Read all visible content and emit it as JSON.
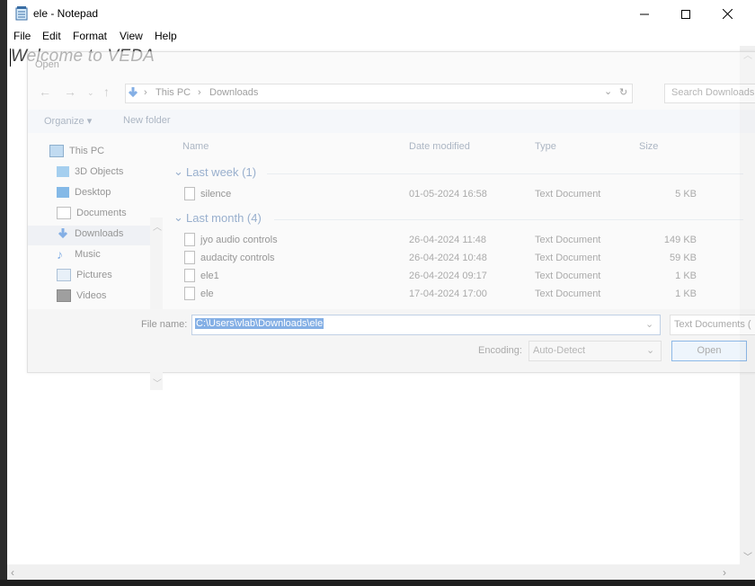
{
  "notepad": {
    "title": "ele - Notepad",
    "menu": [
      "File",
      "Edit",
      "Format",
      "View",
      "Help"
    ],
    "content": "Welcome to VEDA"
  },
  "dialog": {
    "title": "Open",
    "breadcrumb": [
      "This PC",
      "Downloads"
    ],
    "search_placeholder": "Search Downloads",
    "toolbar": {
      "organize": "Organize ▾",
      "new_folder": "New folder"
    },
    "nav_items": [
      {
        "label": "This PC",
        "icon": "pc-icon"
      },
      {
        "label": "3D Objects",
        "icon": "cube-icon"
      },
      {
        "label": "Desktop",
        "icon": "desktop-icon"
      },
      {
        "label": "Documents",
        "icon": "documents-icon"
      },
      {
        "label": "Downloads",
        "icon": "download-arrow-icon"
      },
      {
        "label": "Music",
        "icon": "music-note-icon"
      },
      {
        "label": "Pictures",
        "icon": "pictures-icon"
      },
      {
        "label": "Videos",
        "icon": "film-icon"
      }
    ],
    "columns": {
      "name": "Name",
      "date": "Date modified",
      "type": "Type",
      "size": "Size"
    },
    "groups": [
      {
        "label": "Last week (1)",
        "files": [
          {
            "name": "silence",
            "date": "01-05-2024 16:58",
            "type": "Text Document",
            "size": "5 KB"
          }
        ]
      },
      {
        "label": "Last month (4)",
        "files": [
          {
            "name": "jyo audio controls",
            "date": "26-04-2024 11:48",
            "type": "Text Document",
            "size": "149 KB"
          },
          {
            "name": "audacity controls",
            "date": "26-04-2024 10:48",
            "type": "Text Document",
            "size": "59 KB"
          },
          {
            "name": "ele1",
            "date": "26-04-2024 09:17",
            "type": "Text Document",
            "size": "1 KB"
          },
          {
            "name": "ele",
            "date": "17-04-2024 17:00",
            "type": "Text Document",
            "size": "1 KB"
          }
        ]
      }
    ],
    "file_name_label": "File name:",
    "file_name_value": "C:\\Users\\vlab\\Downloads\\ele",
    "file_type": "Text Documents (",
    "encoding_label": "Encoding:",
    "encoding_value": "Auto-Detect",
    "open_button": "Open"
  }
}
